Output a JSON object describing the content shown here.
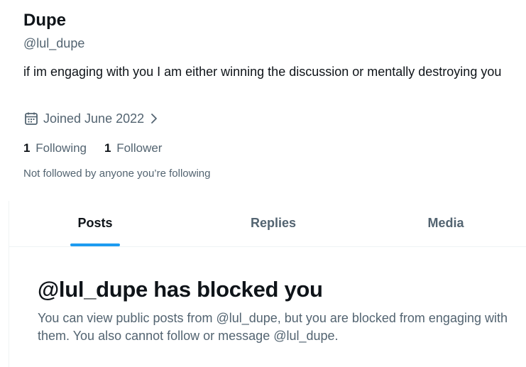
{
  "profile": {
    "display_name": "Dupe",
    "handle": "@lul_dupe",
    "bio": "if im engaging with you I am either winning the discussion or mentally destroying you",
    "joined": "Joined June 2022",
    "following_count": "1",
    "following_label": "Following",
    "follower_count": "1",
    "follower_label": "Follower",
    "followers_note": "Not followed by anyone you’re following"
  },
  "tabs": [
    {
      "label": "Posts",
      "active": true
    },
    {
      "label": "Replies",
      "active": false
    },
    {
      "label": "Media",
      "active": false
    }
  ],
  "blocked": {
    "title": "@lul_dupe has blocked you",
    "body": "You can view public posts from @lul_dupe, but you are blocked from engaging with them. You also cannot follow or message @lul_dupe."
  },
  "colors": {
    "text_primary": "#0f1419",
    "text_secondary": "#536471",
    "accent": "#1d9bf0",
    "divider": "#eff3f4"
  },
  "icons": {
    "joined": "calendar-icon",
    "joined_chevron": "chevron-right-icon"
  }
}
